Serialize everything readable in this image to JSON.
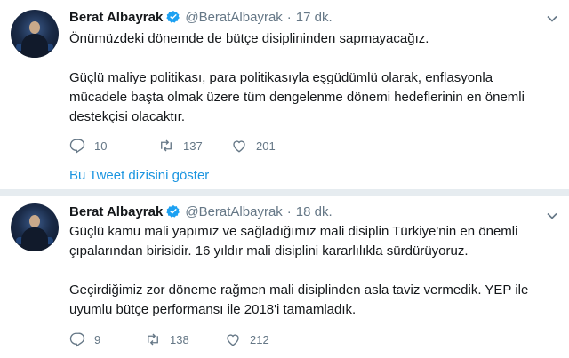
{
  "tweets": [
    {
      "name": "Berat Albayrak",
      "handle": "@BeratAlbayrak",
      "separator": "·",
      "time": "17 dk.",
      "paragraphs": [
        "Önümüzdeki dönemde de bütçe disiplininden sapmayacağız.",
        "Güçlü maliye politikası, para politikasıyla eşgüdümlü olarak, enflasyonla mücadele başta olmak üzere tüm dengelenme dönemi hedeflerinin en önemli destekçisi olacaktır."
      ],
      "replies": "10",
      "retweets": "137",
      "likes": "201",
      "thread_link": "Bu Tweet dizisini göster"
    },
    {
      "name": "Berat Albayrak",
      "handle": "@BeratAlbayrak",
      "separator": "·",
      "time": "18 dk.",
      "paragraphs": [
        "Güçlü kamu mali yapımız ve sağladığımız mali disiplin Türkiye'nin en önemli çıpalarından birisidir. 16 yıldır mali disiplini kararlılıkla sürdürüyoruz.",
        "Geçirdiğimiz zor döneme rağmen mali disiplinden asla taviz vermedik. YEP ile uyumlu bütçe performansı ile 2018'i tamamladık."
      ],
      "replies": "9",
      "retweets": "138",
      "likes": "212"
    }
  ],
  "colors": {
    "text": "#14171a",
    "secondary": "#657786",
    "link": "#1b95e0",
    "verified": "#1da1f2",
    "divider": "#e6ecf0"
  }
}
